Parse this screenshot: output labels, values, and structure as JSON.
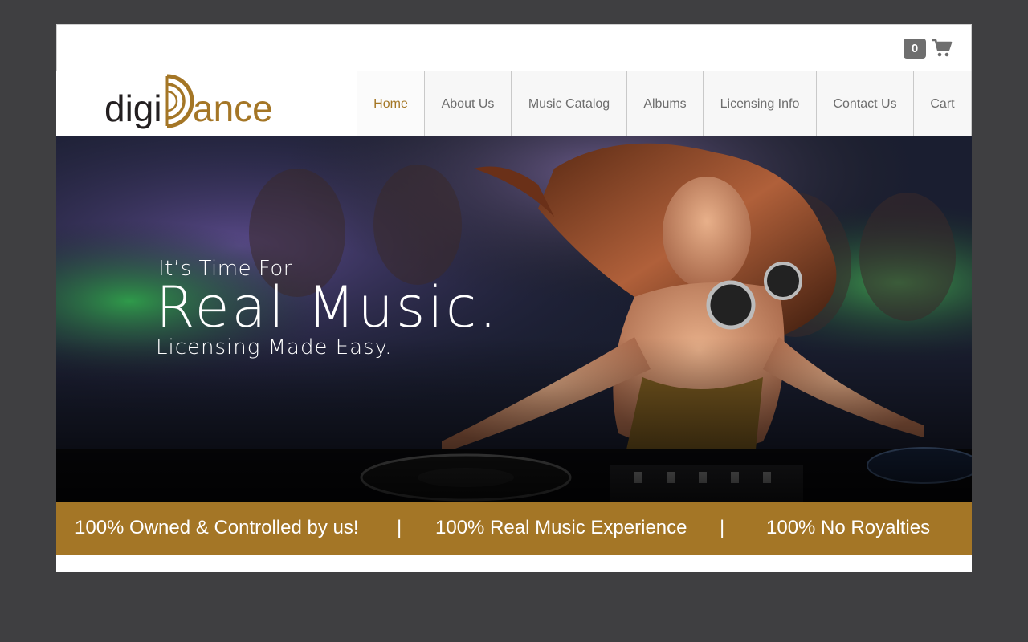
{
  "cart": {
    "count": "0",
    "icon": "cart-icon"
  },
  "logo": {
    "text_dark": "digi",
    "text_gold": "ance",
    "colors": {
      "dark": "#231f20",
      "gold": "#a47626"
    }
  },
  "nav": {
    "items": [
      {
        "label": "Home",
        "active": true
      },
      {
        "label": "About Us"
      },
      {
        "label": "Music Catalog"
      },
      {
        "label": "Albums"
      },
      {
        "label": "Licensing Info"
      },
      {
        "label": "Contact Us"
      },
      {
        "label": "Cart"
      }
    ]
  },
  "hero": {
    "line1": "It’s Time For",
    "line2": "Real Music.",
    "line3": "Licensing Made Easy."
  },
  "strip": {
    "item1": "100% Owned & Controlled by us!",
    "sep1": "|",
    "item2": "100% Real Music Experience",
    "sep2": "|",
    "item3": "100% No Royalties"
  },
  "colors": {
    "accent": "#a47626",
    "page_bg": "#3f3f41",
    "nav_text": "#6d6d6d"
  }
}
